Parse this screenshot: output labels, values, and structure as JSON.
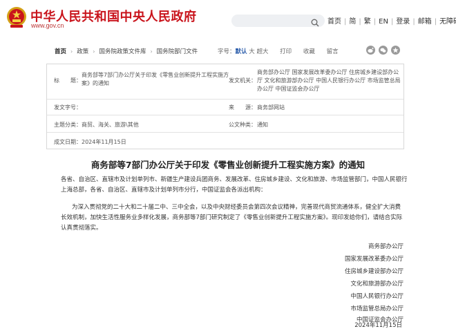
{
  "header": {
    "site_title": "中华人民共和国中央人民政府",
    "site_url": "www.gov.cn",
    "links": [
      "首页",
      "简",
      "繁",
      "EN",
      "登录",
      "邮箱",
      "无障碍"
    ]
  },
  "breadcrumb": [
    "首页",
    "政策",
    "国务院政策文件库",
    "国务院部门文件"
  ],
  "tools": {
    "font_size_label": "字号：",
    "font_default": "默认",
    "font_large": "大",
    "font_xlarge": "超大",
    "print": "打印",
    "favorite": "收藏",
    "leave": "留言"
  },
  "info": {
    "title_label": "标　　题：",
    "title_value": "商务部等7部门办公厅关于印发《零售业创新提升工程实施方案》的通知",
    "issuer_label": "发文机关：",
    "issuer_value": "商务部办公厅 国家发展改革委办公厅 住房城乡建设部办公厅 文化和旅游部办公厅 中国人民银行办公厅 市场监管总局办公厅 中国证监会办公厅",
    "docno_label": "发文字号：",
    "docno_value": "",
    "source_label": "来　　源：",
    "source_value": "商务部网站",
    "topic_label": "主题分类：",
    "topic_value": "商贸、海关、旅游\\其他",
    "type_label": "公文种类：",
    "type_value": "通知",
    "date_label": "成文日期：",
    "date_value": "2024年11月15日"
  },
  "article": {
    "title": "商务部等7部门办公厅关于印发《零售业创新提升工程实施方案》的通知",
    "recipients_l1": "各省、自治区、直辖市及计划单列市、新疆生产建设兵团商务、发展改革、住房城乡建设、文化和旅游、市场监管部门，中国人民银行",
    "recipients_l2": "上海总部，各省、自治区、直辖市及计划单列市分行，中国证监会各派出机构：",
    "body_l1": "为深入贯彻党的二十大和二十届二中、三中全会，以及中央财经委员会第四次会议精神，完善现代商贸流通体系，健全扩大消费",
    "body_l2": "长效机制，加快生活性服务业多样化发展，商务部等7部门研究制定了《零售业创新提升工程实施方案》。现印发给你们，请结合实际",
    "body_l3": "认真贯彻落实。",
    "signatories": [
      "商务部办公厅",
      "国家发展改革委办公厅",
      "住房城乡建设部办公厅",
      "文化和旅游部办公厅",
      "中国人民银行办公厅",
      "市场监管总局办公厅",
      "中国证监会办公厅"
    ],
    "date": "2024年11月15日"
  }
}
